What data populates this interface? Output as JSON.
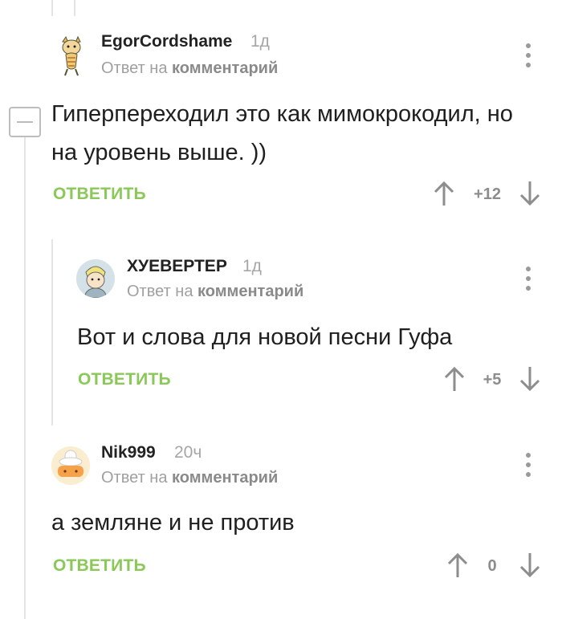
{
  "colors": {
    "accent": "#8ac858",
    "muted": "#a0a0a0",
    "thread_line": "#e4e4e4"
  },
  "comments": [
    {
      "username": "EgorCordshame",
      "time": "1д",
      "reply_prefix": "Ответ на",
      "reply_link": "комментарий",
      "text": "Гиперпереходил это как мимокрокодил, но на уровень выше. ))",
      "reply_label": "ОТВЕТИТЬ",
      "score": "+12"
    },
    {
      "username": "ХУЕВЕРТЕР",
      "time": "1д",
      "reply_prefix": "Ответ на",
      "reply_link": "комментарий",
      "text": "Вот и слова для новой песни Гуфа",
      "reply_label": "ОТВЕТИТЬ",
      "score": "+5"
    },
    {
      "username": "Nik999",
      "time": "20ч",
      "reply_prefix": "Ответ на",
      "reply_link": "комментарий",
      "text": "а земляне и не против",
      "reply_label": "ОТВЕТИТЬ",
      "score": "0"
    }
  ],
  "icons": {
    "collapse": "collapse-minus-icon",
    "upvote": "arrow-up-icon",
    "downvote": "arrow-down-icon",
    "menu": "kebab-menu-icon"
  }
}
